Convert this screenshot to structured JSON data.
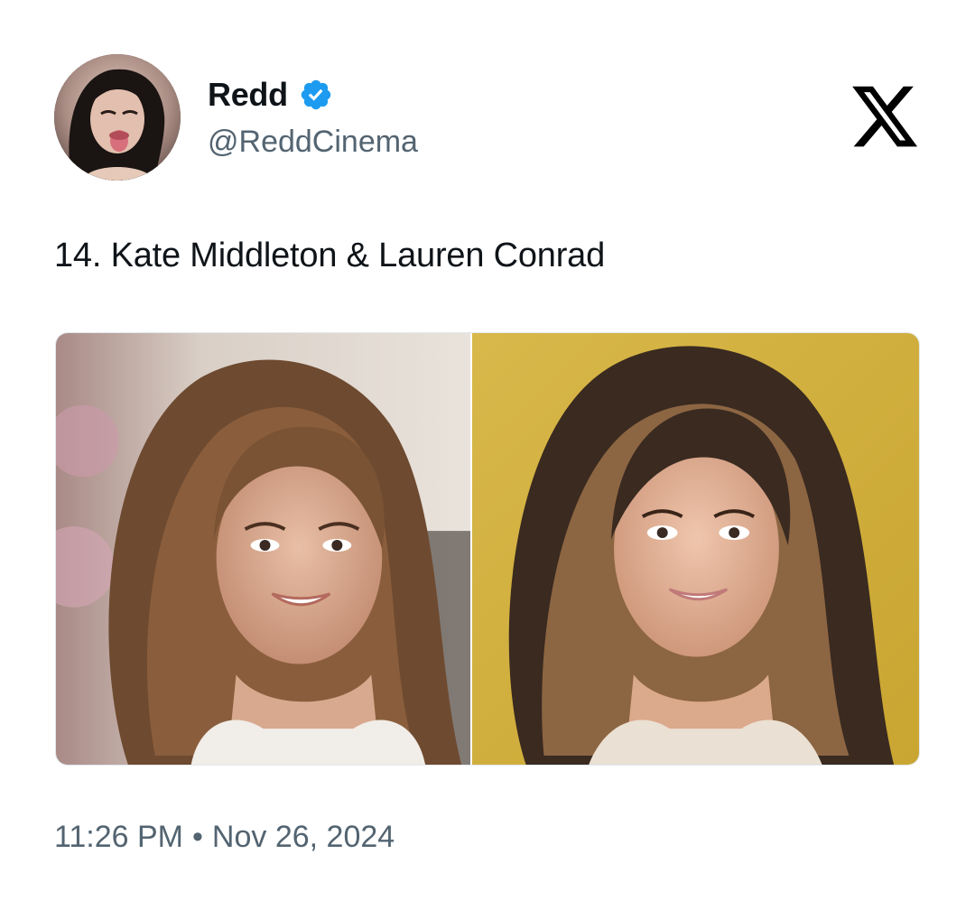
{
  "author": {
    "display_name": "Redd",
    "handle": "@ReddCinema",
    "verified": true,
    "verified_color": "#1d9bf0",
    "avatar_icon": "profile-photo"
  },
  "brand": {
    "logo_icon": "x-logo",
    "color": "#000000"
  },
  "tweet": {
    "text": "14. Kate Middleton & Lauren Conrad"
  },
  "media": {
    "photos": [
      {
        "icon": "portrait-photo-kate-middleton"
      },
      {
        "icon": "portrait-photo-lauren-conrad"
      }
    ]
  },
  "meta": {
    "time": "11:26 PM",
    "separator": "•",
    "date": "Nov 26, 2024"
  },
  "colors": {
    "text": "#0f1419",
    "secondary": "#536471",
    "background": "#ffffff"
  }
}
